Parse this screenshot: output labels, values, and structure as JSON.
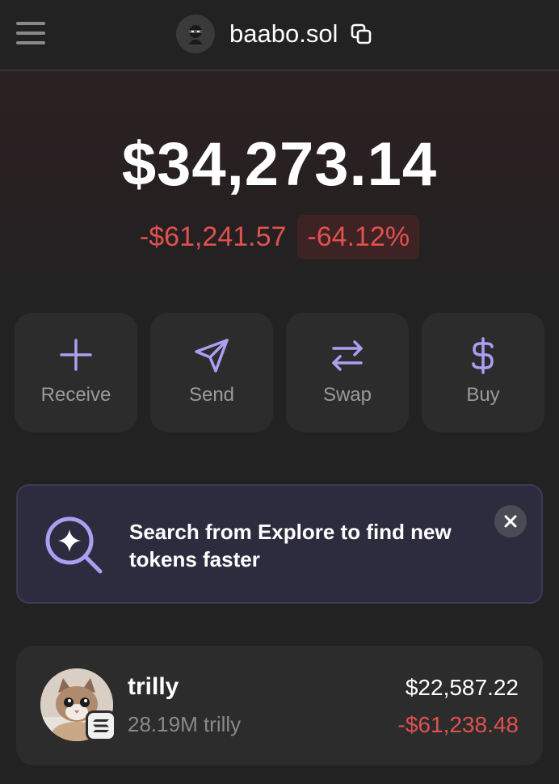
{
  "header": {
    "account_name": "baabo.sol"
  },
  "portfolio": {
    "balance": "$34,273.14",
    "change_amount": "-$61,241.57",
    "change_percent": "-64.12%"
  },
  "actions": [
    {
      "label": "Receive",
      "icon": "plus-icon"
    },
    {
      "label": "Send",
      "icon": "send-icon"
    },
    {
      "label": "Swap",
      "icon": "swap-icon"
    },
    {
      "label": "Buy",
      "icon": "dollar-icon"
    }
  ],
  "banner": {
    "text": "Search from Explore to find new tokens faster",
    "icon": "search-sparkle-icon"
  },
  "tokens": [
    {
      "name": "trilly",
      "quantity": "28.19M trilly",
      "value": "$22,587.22",
      "change": "-$61,238.48"
    }
  ],
  "colors": {
    "accent": "#ab9ff2",
    "negative": "#e0514f",
    "background": "#222222",
    "card": "#2c2c2c"
  }
}
